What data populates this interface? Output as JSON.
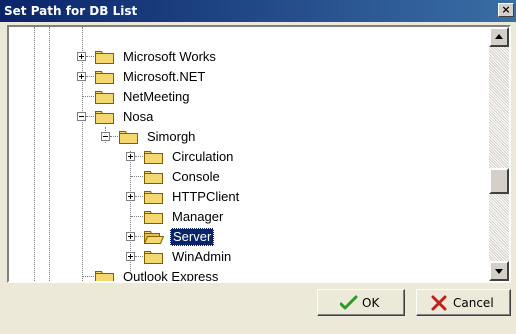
{
  "dialog": {
    "title": "Set Path for DB List",
    "close_glyph": "×"
  },
  "tree": {
    "items": [
      {
        "label": "Microsoft Works",
        "expander": "plus",
        "selected": false
      },
      {
        "label": "Microsoft.NET",
        "expander": "plus",
        "selected": false
      },
      {
        "label": "NetMeeting",
        "expander": "none",
        "selected": false
      },
      {
        "label": "Nosa",
        "expander": "minus",
        "selected": false
      },
      {
        "label": "Simorgh",
        "expander": "minus",
        "selected": false
      },
      {
        "label": "Circulation",
        "expander": "plus",
        "selected": false
      },
      {
        "label": "Console",
        "expander": "none",
        "selected": false
      },
      {
        "label": "HTTPClient",
        "expander": "plus",
        "selected": false
      },
      {
        "label": "Manager",
        "expander": "none",
        "selected": false
      },
      {
        "label": "Server",
        "expander": "plus",
        "selected": true
      },
      {
        "label": "WinAdmin",
        "expander": "plus",
        "selected": false
      },
      {
        "label": "Outlook Express",
        "expander": "none",
        "selected": false
      }
    ]
  },
  "buttons": {
    "ok_label": "OK",
    "cancel_label": "Cancel"
  },
  "colors": {
    "folder_fill": "#f5d770",
    "folder_stroke": "#806000",
    "selection": "#0a246a",
    "ok_check": "#2a9a2a",
    "cancel_x": "#c02020"
  },
  "icons": {
    "folder": "folder-icon",
    "ok": "checkmark-icon",
    "cancel": "x-icon",
    "scroll_up": "arrow-up-icon",
    "scroll_down": "arrow-down-icon"
  }
}
